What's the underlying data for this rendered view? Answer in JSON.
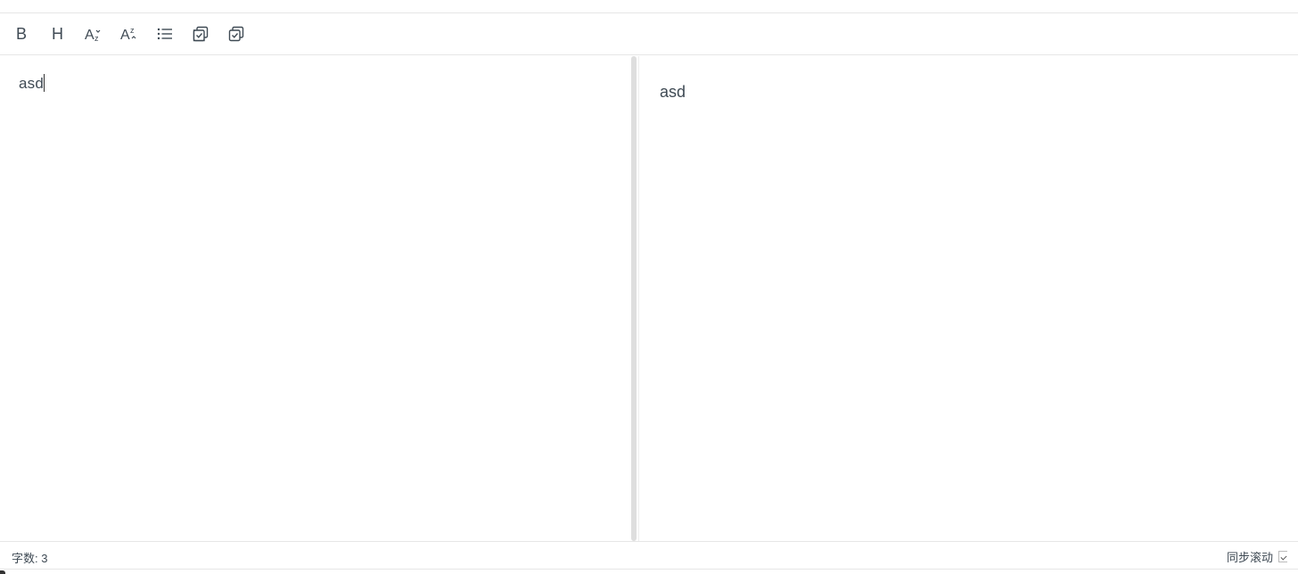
{
  "toolbar": {
    "buttons": [
      {
        "name": "bold",
        "icon": "bold-icon"
      },
      {
        "name": "heading",
        "icon": "heading-icon"
      },
      {
        "name": "subscript",
        "icon": "subscript-icon"
      },
      {
        "name": "superscript",
        "icon": "superscript-icon"
      },
      {
        "name": "unordered-list",
        "icon": "list-icon"
      },
      {
        "name": "copy",
        "icon": "copy-check-icon"
      },
      {
        "name": "copy-alt",
        "icon": "copy-check-icon"
      }
    ]
  },
  "editor": {
    "input_text": "asd"
  },
  "preview": {
    "text": "asd"
  },
  "statusbar": {
    "word_count_label": "字数:",
    "word_count_value": "3",
    "sync_scroll_label": "同步滚动",
    "sync_scroll_checked": true
  },
  "colors": {
    "text": "#3f4a54",
    "border": "#e6e6e6",
    "scrollbar": "#dedede"
  }
}
